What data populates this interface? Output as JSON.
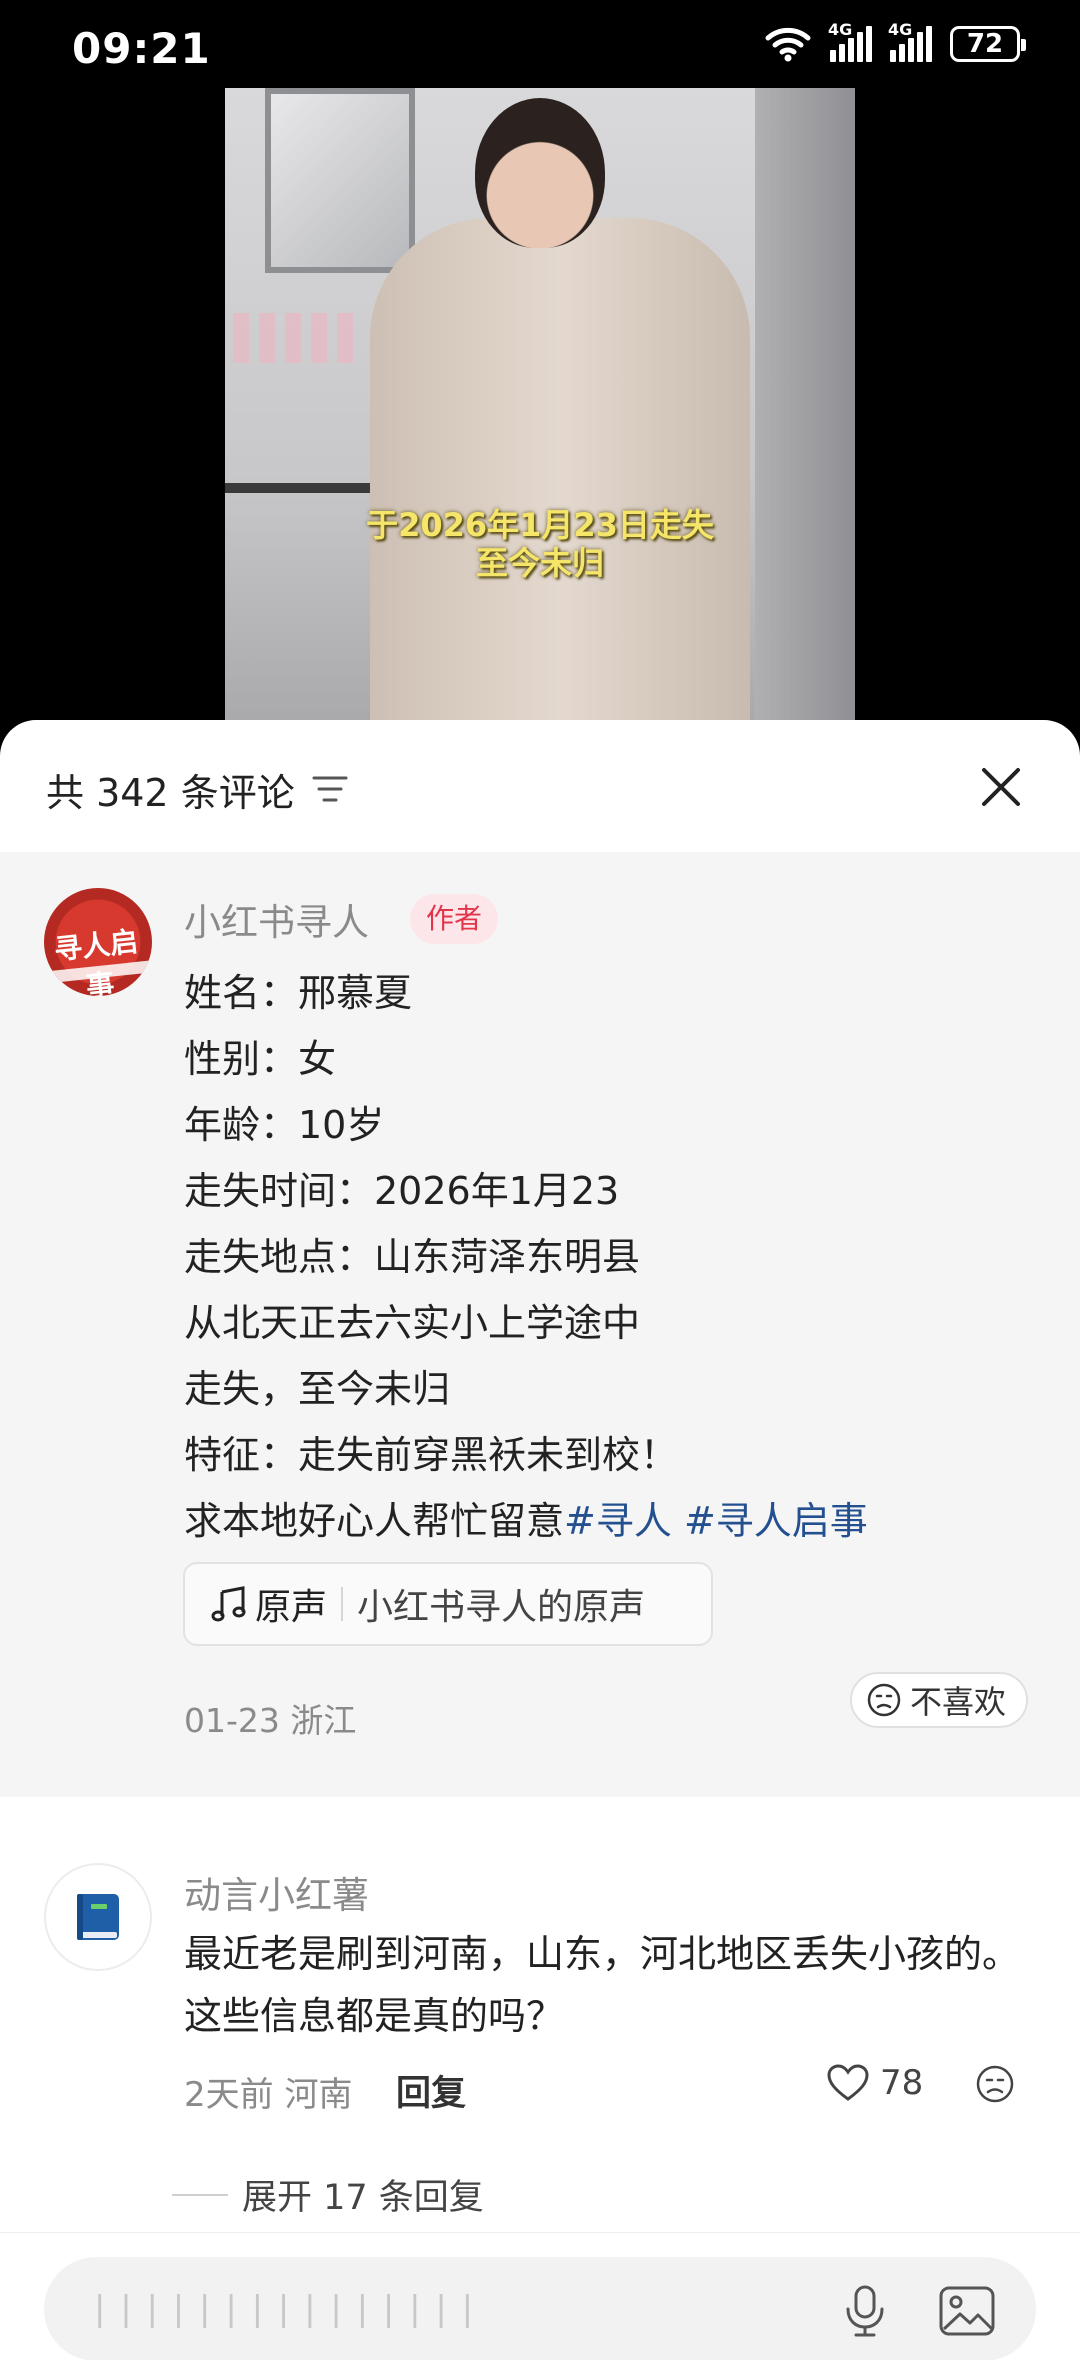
{
  "status_bar": {
    "time": "09:21",
    "signal_1_label": "4G",
    "signal_2_label": "4G",
    "battery": "72"
  },
  "video": {
    "subtitle_line_1": "于2026年1月23日走失",
    "subtitle_line_2": "至今未归",
    "avatar_text": "寻人启事"
  },
  "comments_sheet": {
    "count_label": "共 342 条评论",
    "close_icon": "close-icon",
    "filter_icon": "filter-icon"
  },
  "post": {
    "author": "小红书寻人",
    "author_badge": "作者",
    "lines": [
      "姓名：邢慕夏",
      "性别：女",
      "年龄：10岁",
      "走失时间：2026年1月23",
      "走失地点：山东菏泽东明县",
      "从北天正去六实小上学途中",
      "走失，至今未归",
      "特征：走失前穿黑袄未到校！"
    ],
    "last_line_text": "求本地好心人帮忙留意",
    "hashtags": [
      "#寻人",
      "#寻人启事"
    ],
    "sound_label": "原声",
    "sound_name": "小红书寻人的原声",
    "meta": "01-23 浙江",
    "dislike_label": "不喜欢"
  },
  "comment": {
    "user": "动言小红薯",
    "text": "最近老是刷到河南，山东，河北地区丢失小孩的。这些信息都是真的吗？",
    "meta": "2天前 河南",
    "reply_label": "回复",
    "likes": "78",
    "expand_label": "展开 17 条回复"
  },
  "input_bar": {
    "placeholder": "| | | | | | | | | | | | | | |",
    "mic_icon": "mic-icon",
    "image_icon": "image-icon"
  }
}
